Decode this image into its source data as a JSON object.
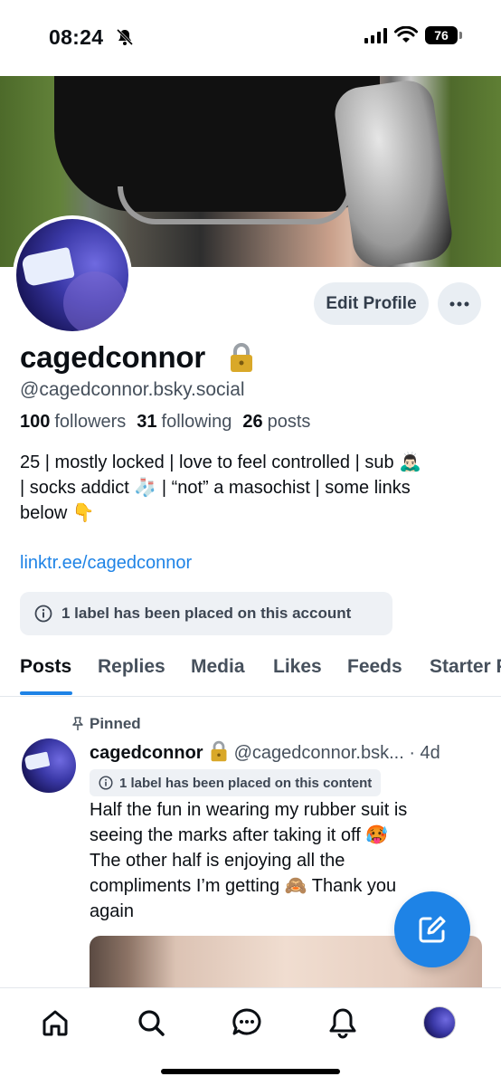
{
  "status_bar": {
    "time": "08:24",
    "battery": "76"
  },
  "profile": {
    "edit_label": "Edit Profile",
    "display_name": "cagedconnor",
    "handle": "@cagedconnor.bsky.social",
    "stats": {
      "followers_count": "100",
      "followers_label": "followers",
      "following_count": "31",
      "following_label": "following",
      "posts_count": "26",
      "posts_label": "posts"
    },
    "bio_lines": [
      "25 | mostly locked | love to feel controlled | sub 🙇🏻‍♂️",
      "| socks addict 🧦 | “not” a masochist | some links",
      "below 👇"
    ],
    "link": "linktr.ee/cagedconnor",
    "label_notice": "1 label has been placed on this account"
  },
  "tabs": [
    "Posts",
    "Replies",
    "Media",
    "Likes",
    "Feeds",
    "Starter Packs"
  ],
  "active_tab": "Posts",
  "post": {
    "pinned_label": "Pinned",
    "author_name": "cagedconnor",
    "author_handle": "@cagedconnor.bsk...",
    "time": "· 4d",
    "label_notice": "1 label has been placed on this content",
    "text_lines": [
      "Half the fun in wearing my rubber suit is",
      "seeing the marks after taking it off 🥵",
      "The other half is enjoying all the",
      "compliments I’m getting 🙈 Thank you",
      "again"
    ]
  },
  "icons": {
    "mute": "bell-slash-icon",
    "more": "ellipsis-icon",
    "info": "info-circle-icon",
    "pin": "pin-icon",
    "compose": "compose-icon",
    "home": "home-icon",
    "search": "search-icon",
    "chat": "chat-bubble-icon",
    "notifications": "bell-icon"
  },
  "colors": {
    "accent": "#1e83e6",
    "muted": "#46505c",
    "chip_bg": "#e9eef3"
  }
}
